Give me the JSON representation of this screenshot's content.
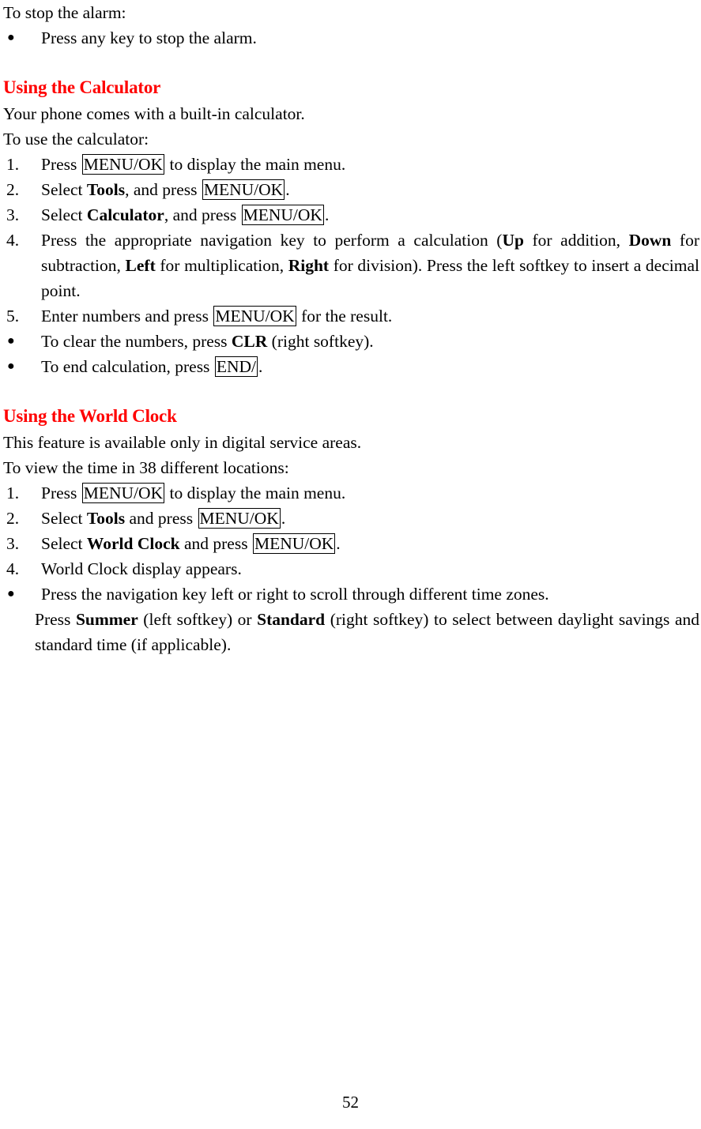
{
  "document": {
    "page_number": "52",
    "heading_color": "#ff0000",
    "body_color": "#000000"
  },
  "alarm_section": {
    "intro": "To stop the alarm:",
    "bullets": [
      {
        "text": "Press any key to stop the alarm."
      }
    ]
  },
  "calculator_section": {
    "heading": "Using the Calculator",
    "intro": "Your phone comes with a built-in calculator.",
    "lead_in": "To use the calculator:",
    "steps": [
      {
        "number": "1.",
        "parts": [
          {
            "type": "text",
            "value": "Press "
          },
          {
            "type": "keybox",
            "value": "MENU/OK"
          },
          {
            "type": "text",
            "value": " to display the main menu."
          }
        ]
      },
      {
        "number": "2.",
        "parts": [
          {
            "type": "text",
            "value": "Select "
          },
          {
            "type": "bold",
            "value": "Tools"
          },
          {
            "type": "text",
            "value": ", and press "
          },
          {
            "type": "keybox",
            "value": "MENU/OK"
          },
          {
            "type": "text",
            "value": "."
          }
        ]
      },
      {
        "number": "3.",
        "parts": [
          {
            "type": "text",
            "value": "Select "
          },
          {
            "type": "bold",
            "value": "Calculator"
          },
          {
            "type": "text",
            "value": ", and press "
          },
          {
            "type": "keybox",
            "value": "MENU/OK"
          },
          {
            "type": "text",
            "value": "."
          }
        ]
      },
      {
        "number": "4.",
        "parts": [
          {
            "type": "text",
            "value": "Press the appropriate navigation key to perform a calculation ("
          },
          {
            "type": "bold",
            "value": "Up"
          },
          {
            "type": "text",
            "value": " for addition, "
          },
          {
            "type": "bold",
            "value": "Down"
          },
          {
            "type": "text",
            "value": " for subtraction, "
          },
          {
            "type": "bold",
            "value": "Left"
          },
          {
            "type": "text",
            "value": " for multiplication, "
          },
          {
            "type": "bold",
            "value": "Right"
          },
          {
            "type": "text",
            "value": " for division).   Press the left softkey to insert a decimal point."
          }
        ]
      },
      {
        "number": "5.",
        "parts": [
          {
            "type": "text",
            "value": "Enter numbers and press "
          },
          {
            "type": "keybox",
            "value": "MENU/OK"
          },
          {
            "type": "text",
            "value": " for the result."
          }
        ]
      }
    ],
    "bullets": [
      {
        "parts": [
          {
            "type": "text",
            "value": "To clear the numbers, press "
          },
          {
            "type": "bold",
            "value": "CLR"
          },
          {
            "type": "text",
            "value": " (right softkey)."
          }
        ]
      },
      {
        "parts": [
          {
            "type": "text",
            "value": "To end calculation, press "
          },
          {
            "type": "keybox",
            "value": "END/"
          },
          {
            "type": "text",
            "value": "."
          }
        ]
      }
    ]
  },
  "world_clock_section": {
    "heading": "Using the World Clock",
    "intro": "This feature is available only in digital service areas.",
    "lead_in": "To view the time in 38 different locations:",
    "steps": [
      {
        "number": "1.",
        "parts": [
          {
            "type": "text",
            "value": "Press "
          },
          {
            "type": "keybox",
            "value": "MENU/OK"
          },
          {
            "type": "text",
            "value": " to display the main menu."
          }
        ]
      },
      {
        "number": "2.",
        "parts": [
          {
            "type": "text",
            "value": "Select "
          },
          {
            "type": "bold",
            "value": "Tools"
          },
          {
            "type": "text",
            "value": " and press "
          },
          {
            "type": "keybox",
            "value": "MENU/OK"
          },
          {
            "type": "text",
            "value": "."
          }
        ]
      },
      {
        "number": "3.",
        "parts": [
          {
            "type": "text",
            "value": "Select "
          },
          {
            "type": "bold",
            "value": "World Clock"
          },
          {
            "type": "text",
            "value": " and press "
          },
          {
            "type": "keybox",
            "value": "MENU/OK"
          },
          {
            "type": "text",
            "value": "."
          }
        ]
      },
      {
        "number": "4.",
        "parts": [
          {
            "type": "text",
            "value": "World Clock display appears."
          }
        ]
      }
    ],
    "bullets": [
      {
        "parts": [
          {
            "type": "text",
            "value": "Press the navigation key left or right to scroll through different time zones."
          }
        ]
      }
    ],
    "continuation": {
      "parts": [
        {
          "type": "text",
          "value": "Press "
        },
        {
          "type": "bold",
          "value": "Summer"
        },
        {
          "type": "text",
          "value": " (left softkey) or "
        },
        {
          "type": "bold",
          "value": "Standard"
        },
        {
          "type": "text",
          "value": " (right softkey) to select between daylight savings and standard time (if applicable)."
        }
      ]
    }
  },
  "icons": {
    "bullet_glyph": "●"
  }
}
